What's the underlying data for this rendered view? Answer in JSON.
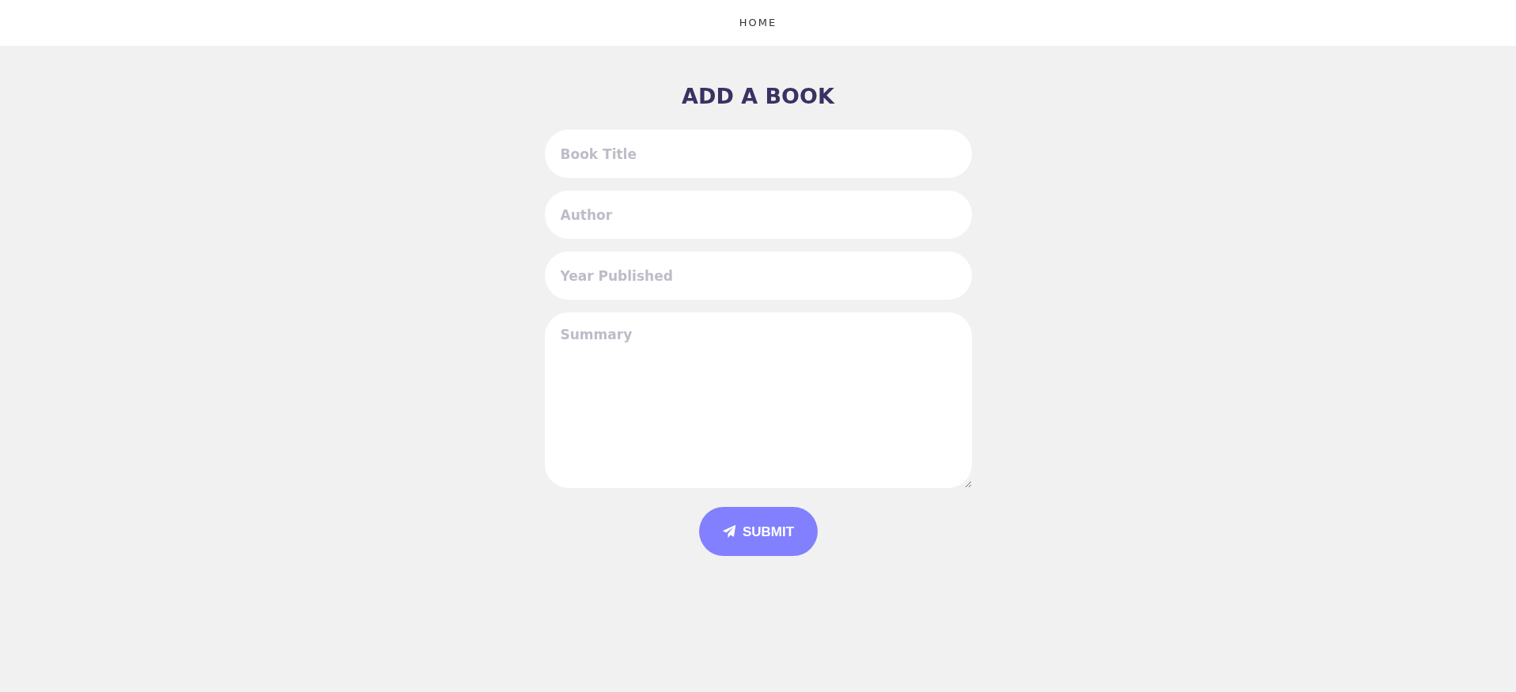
{
  "nav": {
    "links": [
      "HOME"
    ]
  },
  "form": {
    "title": "ADD A BOOK",
    "fields": [
      {
        "kind": "input",
        "placeholder": "Book Title"
      },
      {
        "kind": "input",
        "placeholder": "Author"
      },
      {
        "kind": "input",
        "placeholder": "Year Published"
      },
      {
        "kind": "textarea",
        "placeholder": "Summary"
      }
    ],
    "submit": "SUBMIT"
  }
}
